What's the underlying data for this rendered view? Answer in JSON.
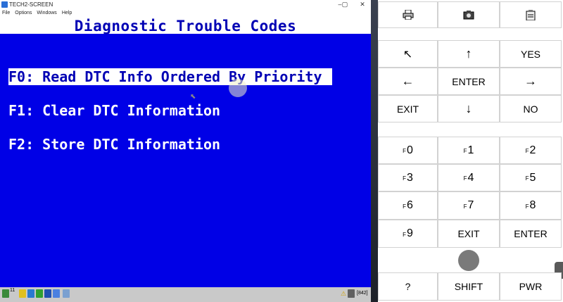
{
  "window": {
    "title": "TECH2-SCREEN",
    "controls": [
      "–",
      "▢",
      "✕"
    ]
  },
  "menubar": [
    "File",
    "Options",
    "Windows",
    "Help"
  ],
  "screen": {
    "title": "Diagnostic Trouble Codes",
    "items": [
      "F0: Read DTC Info Ordered By Priority",
      "F1: Clear DTC Information",
      "F2: Store DTC Information"
    ],
    "selected_index": 0
  },
  "taskbar": {
    "count": "11",
    "status": "[842]"
  },
  "keypad": {
    "row_icons": [
      "printer-icon",
      "camera-icon",
      "clipboard-icon"
    ],
    "nav": {
      "up_left": "↖",
      "up": "↑",
      "yes": "YES",
      "left": "←",
      "enter": "ENTER",
      "right": "→",
      "exit": "EXIT",
      "down": "↓",
      "no": "NO"
    },
    "fkeys": [
      {
        "prefix": "F",
        "num": "0"
      },
      {
        "prefix": "F",
        "num": "1"
      },
      {
        "prefix": "F",
        "num": "2"
      },
      {
        "prefix": "F",
        "num": "3"
      },
      {
        "prefix": "F",
        "num": "4"
      },
      {
        "prefix": "F",
        "num": "5"
      },
      {
        "prefix": "F",
        "num": "6"
      },
      {
        "prefix": "F",
        "num": "7"
      },
      {
        "prefix": "F",
        "num": "8"
      },
      {
        "prefix": "F",
        "num": "9"
      }
    ],
    "exit2": "EXIT",
    "enter2": "ENTER",
    "help": "?",
    "shift": "SHIFT",
    "pwr": "PWR"
  }
}
